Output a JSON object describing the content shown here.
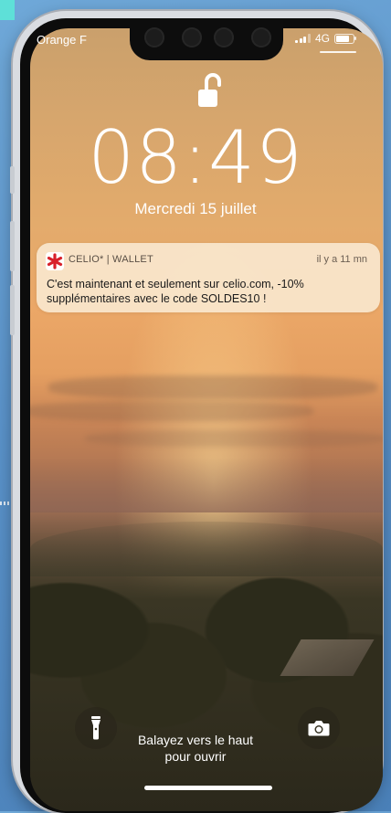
{
  "status_bar": {
    "carrier": "Orange F",
    "network": "4G",
    "signal_bars": 3,
    "battery_level": 0.75
  },
  "lock_screen": {
    "time": "08:49",
    "date": "Mercredi 15 juillet",
    "swipe_hint_line1": "Balayez vers le haut",
    "swipe_hint_line2": "pour ouvrir"
  },
  "notification": {
    "app_name": "CELIO* | WALLET",
    "time_ago": "il y a 11 mn",
    "message_line1": "C'est maintenant et seulement sur celio.com, -10%",
    "message_line2": "supplémentaires avec le code SOLDES10 !",
    "icon": "celio-star-icon",
    "icon_color": "#d8202a"
  },
  "controls": {
    "left_icon": "flashlight-icon",
    "right_icon": "camera-icon"
  },
  "colors": {
    "background": "#5a92c9",
    "accent": "#5ee0d8",
    "notification_bg": "#faecd6"
  }
}
